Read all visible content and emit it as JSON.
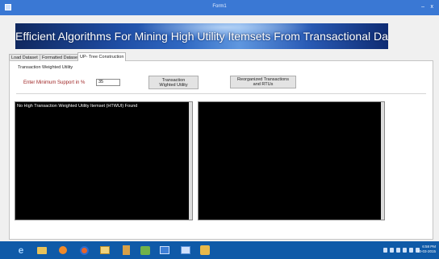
{
  "window": {
    "title": "Form1",
    "minimize": "–",
    "close": "x"
  },
  "banner": {
    "title": "Efficient Algorithms For Mining High Utility Itemsets From Transactional Database"
  },
  "tabs": [
    {
      "label": "Load Dataset"
    },
    {
      "label": "Formatted Dataset"
    },
    {
      "label": "UP- Tree Construction",
      "active": true
    }
  ],
  "section": {
    "title": "Transaction Weighted Utility"
  },
  "support": {
    "label": "Enter Minimum Support in %",
    "value": "35"
  },
  "buttons": {
    "twu": "Transaction Wighted Utility",
    "reorganized": "Reorganized Transactions and RTUs"
  },
  "output": {
    "left_text": "No High Transaction Weighted Utility Itemset (HTWUI) Found",
    "right_text": ""
  },
  "taskbar": {
    "icons": [
      "ie-icon",
      "folder-icon",
      "media-icon",
      "firefox-icon",
      "explorer-icon",
      "app-icon",
      "app-icon",
      "app-icon",
      "app-icon",
      "app-icon"
    ]
  },
  "clock": {
    "time": "6:58 PM",
    "date": "10-03-2015"
  }
}
